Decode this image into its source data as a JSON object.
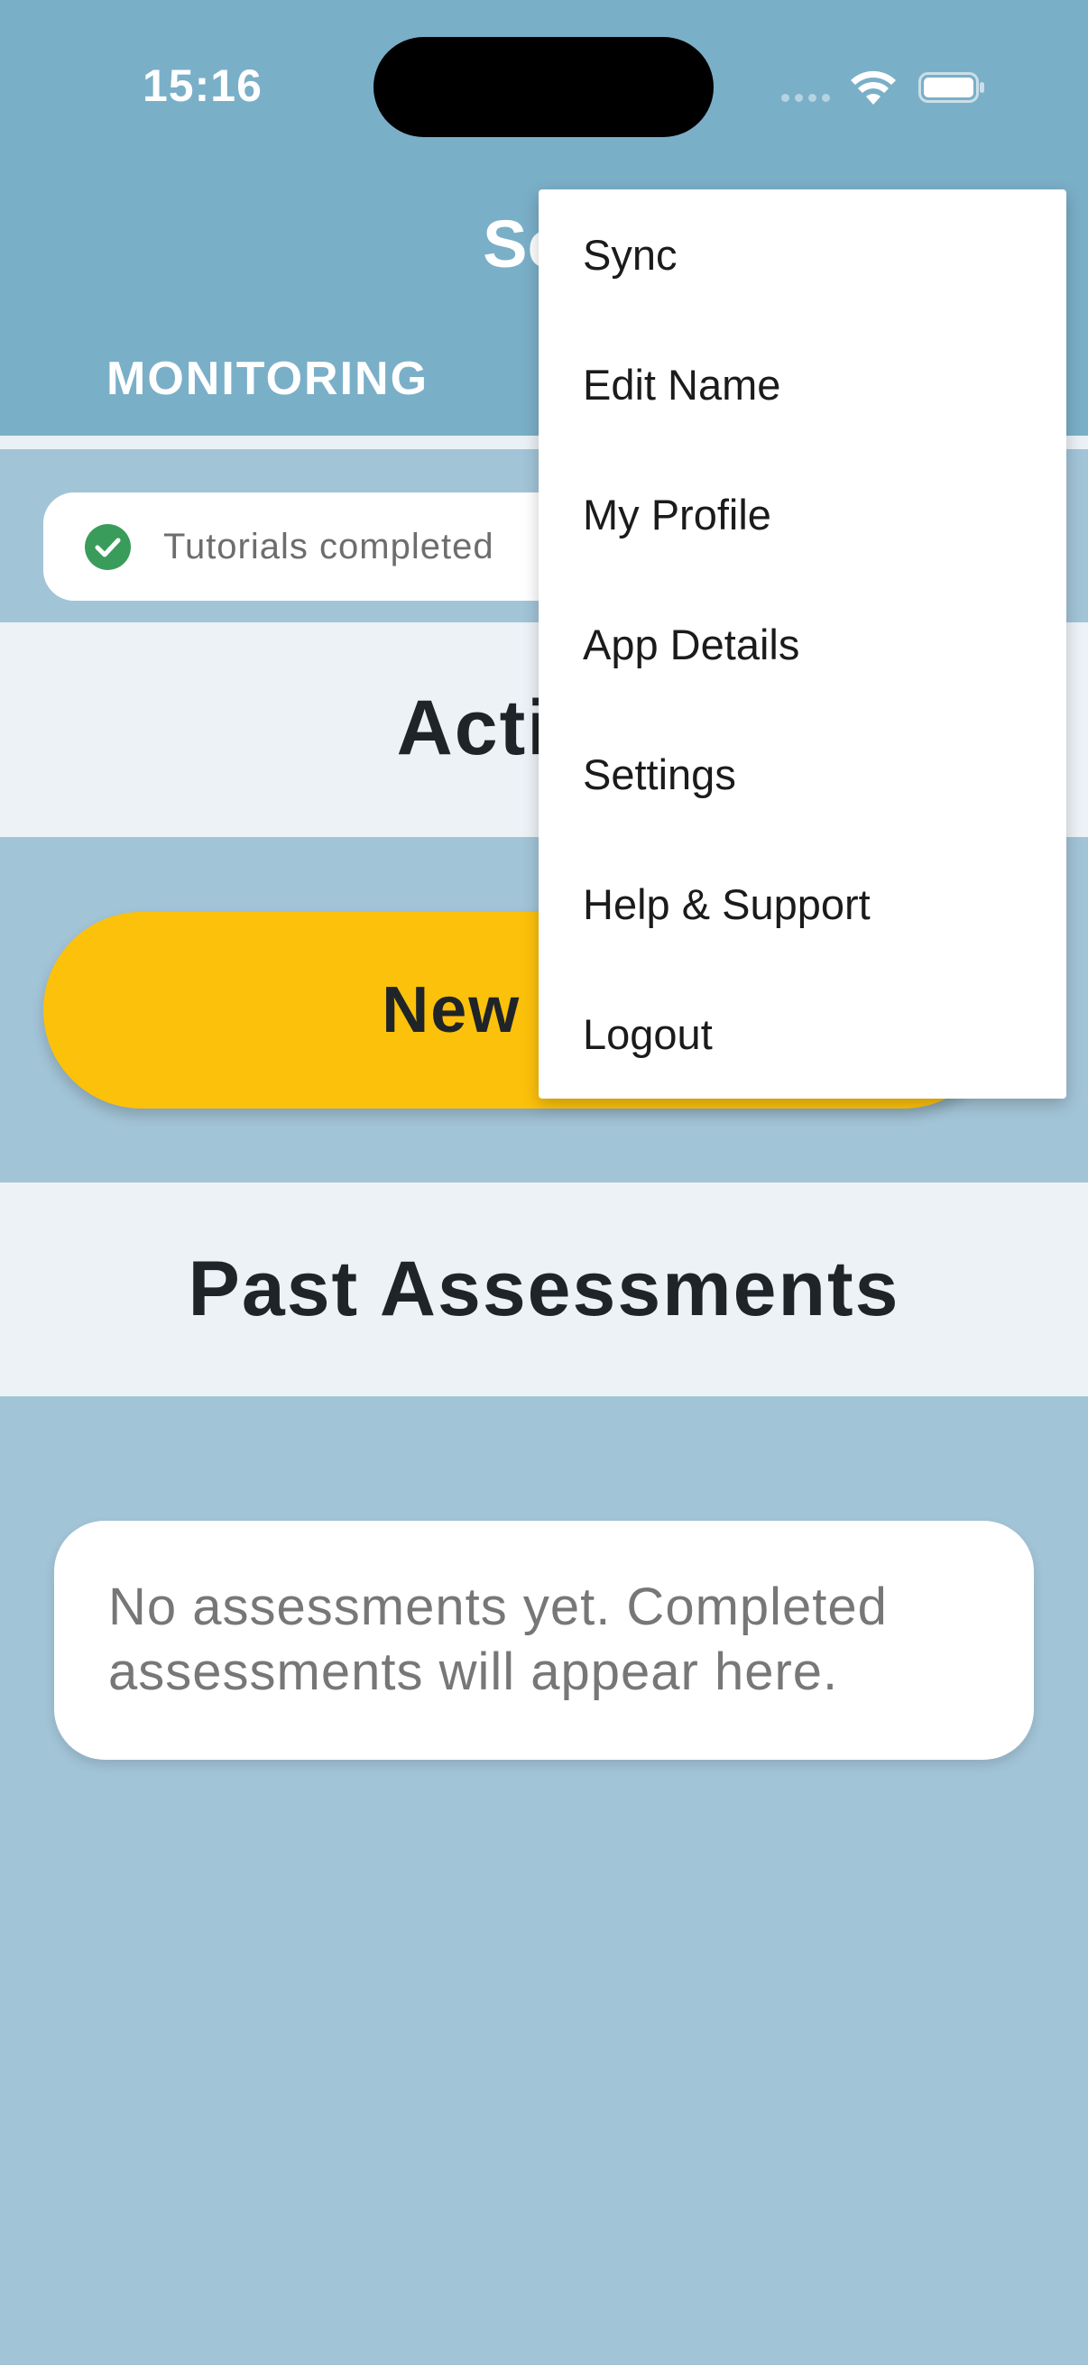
{
  "status_bar": {
    "time": "15:16",
    "icons": [
      "signal-icon",
      "wifi-icon",
      "battery-icon"
    ]
  },
  "header": {
    "title_visible": "Sch",
    "tabs": [
      {
        "label": "MONITORING"
      }
    ]
  },
  "tutorial_banner": {
    "text": "Tutorials completed",
    "icon": "check-circle-icon"
  },
  "activity": {
    "heading": "Activity",
    "new_button_label": "New Ass"
  },
  "past_assessments": {
    "heading": "Past Assessments",
    "empty_text": "No assessments yet. Completed assessments will appear here."
  },
  "menu": {
    "items": [
      {
        "label": "Sync"
      },
      {
        "label": "Edit Name"
      },
      {
        "label": "My Profile"
      },
      {
        "label": "App Details"
      },
      {
        "label": "Settings"
      },
      {
        "label": "Help & Support"
      },
      {
        "label": "Logout"
      }
    ]
  },
  "colors": {
    "header": "#7aafc8",
    "background": "#a2c4d7",
    "band": "#edf2f7",
    "accent_button": "#fcc10b",
    "success": "#3a9c5b"
  }
}
